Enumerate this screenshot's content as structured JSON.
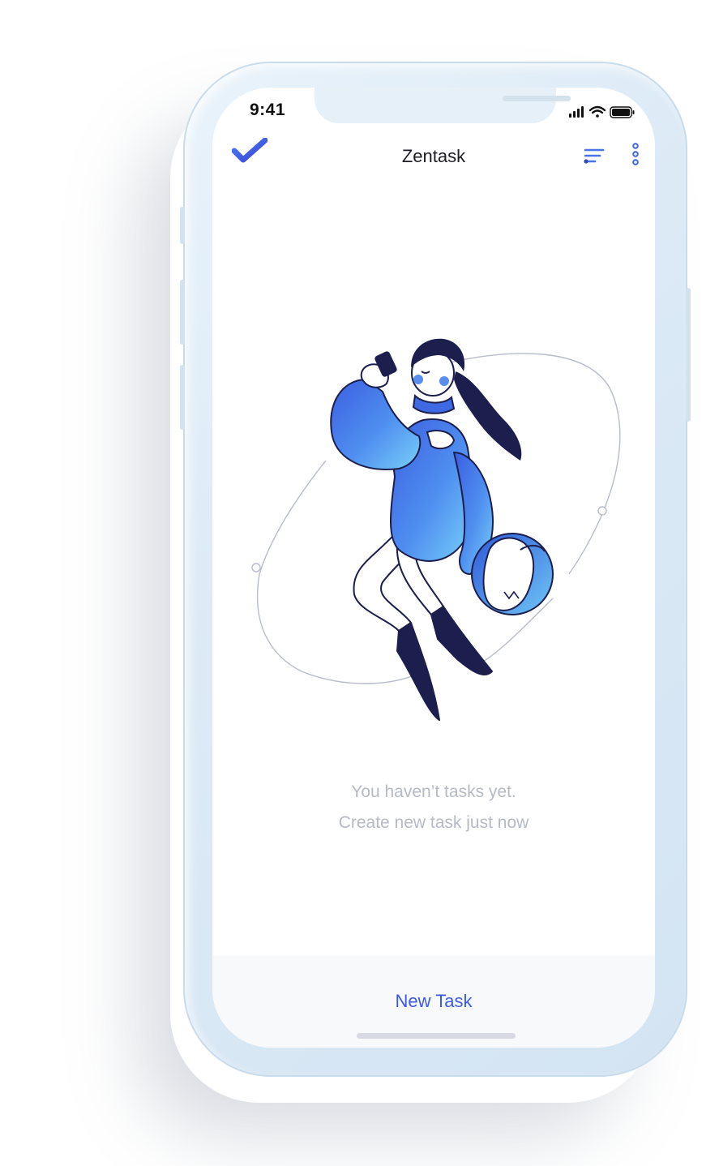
{
  "status_bar": {
    "time": "9:41"
  },
  "app_bar": {
    "title": "Zentask",
    "logo_icon": "check-icon",
    "filter_icon": "filter-icon",
    "more_icon": "more-vertical-icon"
  },
  "empty_state": {
    "line1": "You haven’t tasks yet.",
    "line2": "Create new task just now"
  },
  "bottom_bar": {
    "new_task_label": "New Task"
  },
  "colors": {
    "accent": "#3b59f0",
    "gradient_start": "#3f6fe0",
    "gradient_end": "#6fc3f7",
    "dark": "#1c1f4d",
    "muted_text": "#b6b9c6"
  }
}
